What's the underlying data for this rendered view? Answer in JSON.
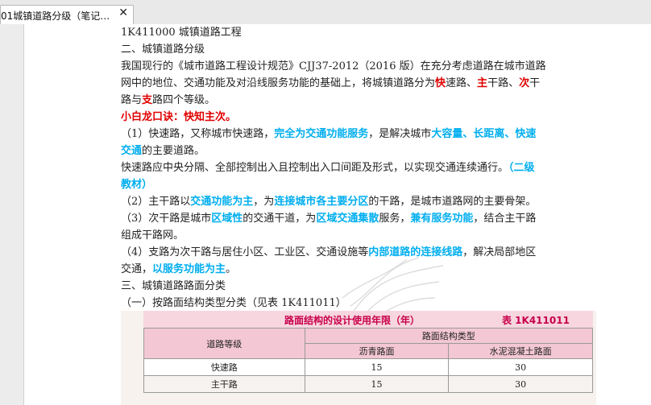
{
  "tab": {
    "title": "01城镇道路分级（笔记…",
    "close_glyph": "✕"
  },
  "document": {
    "lines": [
      [
        {
          "t": "1K411000   城镇道路工程",
          "s": ""
        }
      ],
      [
        {
          "t": "二、城镇道路分级",
          "s": ""
        }
      ],
      [
        {
          "t": "我国现行的《城市道路工程设计规范》CJJ37-2012（2016 版）在充分考虑道路在城市道路",
          "s": ""
        }
      ],
      [
        {
          "t": "网中的地位、交通功能及对沿线服务功能的基础上，将城镇道路分为",
          "s": ""
        },
        {
          "t": "快",
          "s": "red"
        },
        {
          "t": "速路、",
          "s": ""
        },
        {
          "t": "主",
          "s": "red"
        },
        {
          "t": "干路、",
          "s": ""
        },
        {
          "t": "次",
          "s": "red"
        },
        {
          "t": "干",
          "s": ""
        }
      ],
      [
        {
          "t": "路与",
          "s": ""
        },
        {
          "t": "支",
          "s": "red"
        },
        {
          "t": "路四个等级。",
          "s": ""
        }
      ],
      [
        {
          "t": "小白龙口诀：快知主次。",
          "s": "red"
        }
      ],
      [
        {
          "t": "（1）快速路，又称城市快速路，",
          "s": ""
        },
        {
          "t": "完全为交通功能服务",
          "s": "blue"
        },
        {
          "t": "，是解决城市",
          "s": ""
        },
        {
          "t": "大容量、长距离、快速",
          "s": "blue"
        }
      ],
      [
        {
          "t": "交通",
          "s": "blue"
        },
        {
          "t": "的主要道路。",
          "s": ""
        }
      ],
      [
        {
          "t": "快速路应中央分隔、全部控制出入且控制出入口间距及形式，以实现交通连续通行。",
          "s": ""
        },
        {
          "t": "（二级",
          "s": "blue"
        }
      ],
      [
        {
          "t": "教材）",
          "s": "blue"
        }
      ],
      [
        {
          "t": "（2）主干路以",
          "s": ""
        },
        {
          "t": "交通功能为主",
          "s": "blue"
        },
        {
          "t": "，为",
          "s": ""
        },
        {
          "t": "连接城市各主要分区",
          "s": "blue"
        },
        {
          "t": "的干路，是城市道路网的主要骨架。",
          "s": ""
        }
      ],
      [
        {
          "t": "（3）次干路是城市",
          "s": ""
        },
        {
          "t": "区域性",
          "s": "blue"
        },
        {
          "t": "的交通干道，为",
          "s": ""
        },
        {
          "t": "区域交通集散",
          "s": "blue"
        },
        {
          "t": "服务，",
          "s": ""
        },
        {
          "t": "兼有服务功能",
          "s": "blue"
        },
        {
          "t": "，结合主干路",
          "s": ""
        }
      ],
      [
        {
          "t": "组成干路网。",
          "s": ""
        }
      ],
      [
        {
          "t": "（4）支路为次干路与居住小区、工业区、交通设施等",
          "s": ""
        },
        {
          "t": "内部道路的连接线路",
          "s": "blue"
        },
        {
          "t": "，解决局部地区",
          "s": ""
        }
      ],
      [
        {
          "t": "交通，",
          "s": ""
        },
        {
          "t": "以服务功能为主",
          "s": "blue"
        },
        {
          "t": "。",
          "s": ""
        }
      ],
      [
        {
          "t": "三、城镇道路路面分类",
          "s": ""
        }
      ],
      [
        {
          "t": "（一）按路面结构类型分类（见表 1K411011）",
          "s": ""
        }
      ]
    ]
  },
  "table": {
    "title": "路面结构的设计使用年限（年）",
    "number": "表 1K411011",
    "col_road_class": "道路等级",
    "col_group": "路面结构类型",
    "col_asphalt": "沥青路面",
    "col_concrete": "水泥混凝土路面",
    "rows": [
      {
        "grade": "快速路",
        "asphalt": "15",
        "concrete": "30"
      },
      {
        "grade": "主干路",
        "asphalt": "15",
        "concrete": "30"
      }
    ]
  },
  "colors": {
    "emphasis_red": "#e00000",
    "emphasis_blue": "#00aeef",
    "table_header_pink": "#f3c7d4",
    "table_title_text": "#c8004b"
  }
}
